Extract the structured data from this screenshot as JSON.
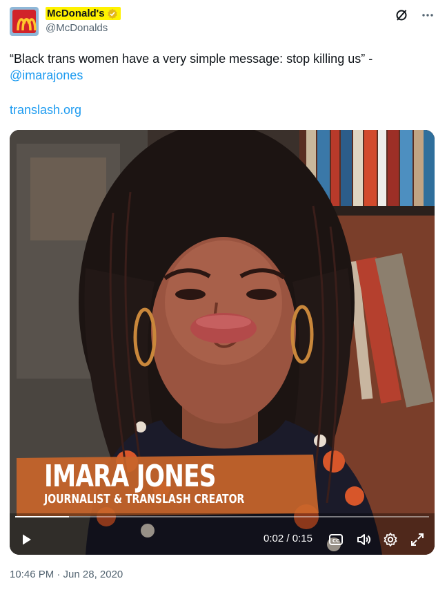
{
  "author": {
    "display_name": "McDonald's",
    "handle": "@McDonalds",
    "avatar_icon": "mcdonalds-logo-icon",
    "verified_icon": "verified-gold-badge-icon"
  },
  "actions": {
    "grok_icon": "grok-icon",
    "more_icon": "more-icon"
  },
  "tweet": {
    "text_main": "“Black trans women have a very simple message: stop killing us” -",
    "mention": "@imarajones",
    "link": "translash.org",
    "timestamp": "10:46 PM · Jun 28, 2020"
  },
  "video": {
    "caption_name": "IMARA JONES",
    "caption_role": "JOURNALIST & TRANSLASH CREATOR",
    "current_time": "0:02",
    "separator": "/",
    "duration": "0:15",
    "progress_fraction": 0.13,
    "icons": [
      "play-icon",
      "captions-icon",
      "volume-icon",
      "settings-icon",
      "fullscreen-icon"
    ]
  },
  "colors": {
    "link": "#1d9bf0",
    "highlight": "#fff200",
    "banner": "#c8652a"
  }
}
